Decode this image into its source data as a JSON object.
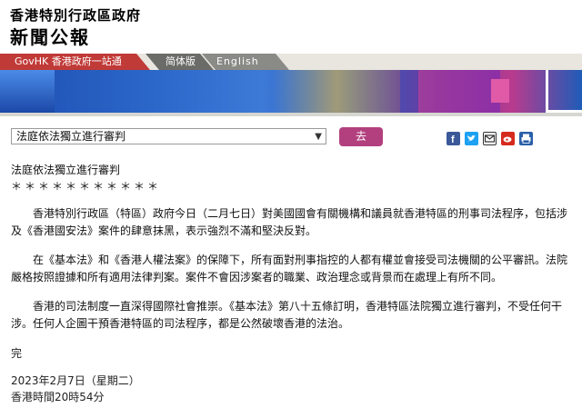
{
  "header": {
    "brand_line1": "香港特別行政區政府",
    "brand_line2": "新聞公報"
  },
  "nav": {
    "govhk": "GovHK 香港政府一站通",
    "simplified": "简体版",
    "english": "English"
  },
  "toolbar": {
    "selected_article": "法庭依法獨立進行審判",
    "go_label": "去"
  },
  "share_icons": [
    "facebook-icon",
    "twitter-icon",
    "email-icon",
    "weibo-icon",
    "print-icon"
  ],
  "article": {
    "title": "法庭依法獨立進行審判",
    "stars": "＊＊＊＊＊＊＊＊＊＊＊",
    "paragraphs": [
      "香港特別行政區（特區）政府今日（二月七日）對美國國會有關機構和議員就香港特區的刑事司法程序，包括涉及《香港國安法》案件的肆意抹黑，表示強烈不滿和堅決反對。",
      "在《基本法》和《香港人權法案》的保障下，所有面對刑事指控的人都有權並會接受司法機關的公平審訊。法院嚴格按照證據和所有適用法律判案。案件不會因涉案者的職業、政治理念或背景而在處理上有所不同。",
      "香港的司法制度一直深得國際社會推崇。《基本法》第八十五條訂明，香港特區法院獨立進行審判，不受任何干涉。任何人企圖干預香港特區的司法程序，都是公然破壞香港的法治。"
    ],
    "end": "完",
    "date": "2023年2月7日（星期二）",
    "time": "香港時間20時54分"
  },
  "colors": {
    "gov_tab": "#c03a37",
    "go_button": "#b3407e",
    "lang_tab": "#6b6b68"
  }
}
